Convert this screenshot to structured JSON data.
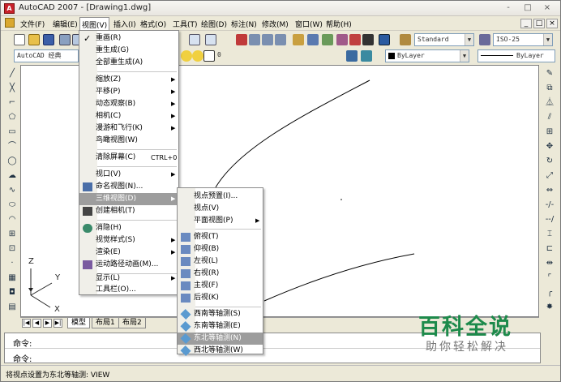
{
  "window": {
    "title": "AutoCAD 2007 - [Drawing1.dwg]",
    "controls": [
      "-",
      "□",
      "×"
    ]
  },
  "menubar": {
    "items": [
      "文件(F)",
      "编辑(E)",
      "视图(V)",
      "插入(I)",
      "格式(O)",
      "工具(T)",
      "绘图(D)",
      "标注(N)",
      "修改(M)",
      "窗口(W)",
      "帮助(H)"
    ],
    "doc_controls": [
      "_",
      "□",
      "×"
    ]
  },
  "toolbar": {
    "workspace": "AutoCAD 经典",
    "text_style": "Standard",
    "dim_style": "ISO-25",
    "layer_value": "0",
    "color_value": "ByLayer",
    "linetype_value": "ByLayer"
  },
  "view_menu": {
    "items": [
      {
        "label": "重画(R)"
      },
      {
        "label": "重生成(G)"
      },
      {
        "label": "全部重生成(A)"
      },
      {
        "label": "缩放(Z)"
      },
      {
        "label": "平移(P)"
      },
      {
        "label": "动态观察(B)"
      },
      {
        "label": "相机(C)"
      },
      {
        "label": "漫游和飞行(K)"
      },
      {
        "label": "鸟瞰视图(W)"
      },
      {
        "label": "清除屏幕(C)",
        "accel": "CTRL+0"
      },
      {
        "label": "视口(V)"
      },
      {
        "label": "命名视图(N)..."
      },
      {
        "label": "三维视图(D)"
      },
      {
        "label": "创建相机(T)"
      },
      {
        "label": "消隐(H)"
      },
      {
        "label": "视觉样式(S)"
      },
      {
        "label": "渲染(E)"
      },
      {
        "label": "运动路径动画(M)..."
      },
      {
        "label": "显示(L)"
      },
      {
        "label": "工具栏(O)..."
      }
    ]
  },
  "view3d_menu": {
    "items": [
      {
        "label": "视点预置(I)..."
      },
      {
        "label": "视点(V)"
      },
      {
        "label": "平面视图(P)"
      },
      {
        "label": "俯视(T)"
      },
      {
        "label": "仰视(B)"
      },
      {
        "label": "左视(L)"
      },
      {
        "label": "右视(R)"
      },
      {
        "label": "主视(F)"
      },
      {
        "label": "后视(K)"
      },
      {
        "label": "西南等轴测(S)"
      },
      {
        "label": "东南等轴测(E)"
      },
      {
        "label": "东北等轴测(N)"
      },
      {
        "label": "西北等轴测(W)"
      }
    ]
  },
  "ucs": {
    "x": "X",
    "y": "Y",
    "z": "Z"
  },
  "tabs": [
    "模型",
    "布局1",
    "布局2"
  ],
  "command": {
    "line1": "命令:",
    "line2": "命令:"
  },
  "status": {
    "text": "将视点设置为东北等轴测:  VIEW"
  },
  "watermark": {
    "title": "百科全说",
    "subtitle": "助你轻松解决"
  },
  "colors": {
    "highlight": "#9d9d9d",
    "watermark_green": "#1d8a4b"
  }
}
